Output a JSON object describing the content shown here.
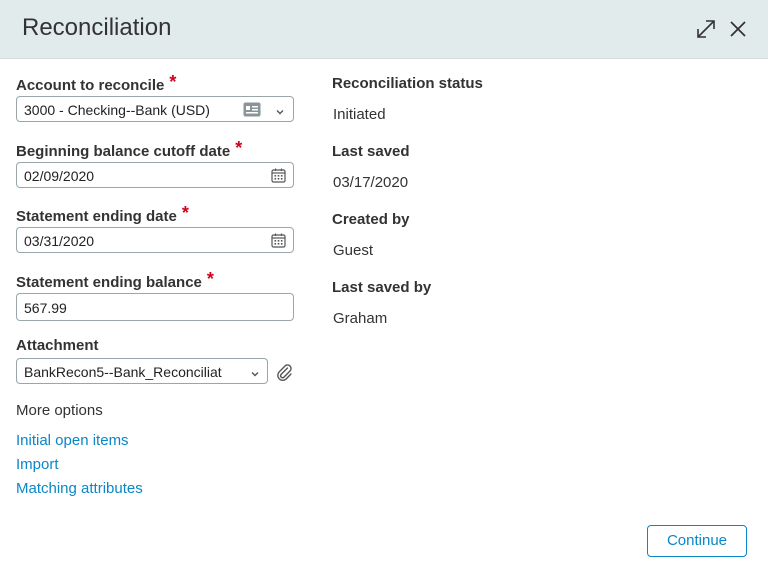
{
  "dialog": {
    "title": "Reconciliation"
  },
  "form": {
    "account": {
      "label": "Account to reconcile",
      "value": "3000 - Checking--Bank (USD)"
    },
    "beginning_cutoff": {
      "label": "Beginning balance cutoff date",
      "value": "02/09/2020"
    },
    "statement_end_date": {
      "label": "Statement ending date",
      "value": "03/31/2020"
    },
    "statement_end_balance": {
      "label": "Statement ending balance",
      "value": "567.99"
    },
    "attachment": {
      "label": "Attachment",
      "value": "BankRecon5--Bank_Reconciliat"
    },
    "required_mark": "*"
  },
  "more_options": {
    "heading": "More options",
    "links": [
      "Initial open items",
      "Import",
      "Matching attributes"
    ]
  },
  "info": {
    "status": {
      "label": "Reconciliation status",
      "value": "Initiated"
    },
    "last_saved": {
      "label": "Last saved",
      "value": "03/17/2020"
    },
    "created_by": {
      "label": "Created by",
      "value": "Guest"
    },
    "last_saved_by": {
      "label": "Last saved by",
      "value": "Graham"
    }
  },
  "actions": {
    "continue_label": "Continue"
  },
  "colors": {
    "header_bg": "#e2ebeb",
    "link": "#0a86c9",
    "required": "#d0021b"
  }
}
